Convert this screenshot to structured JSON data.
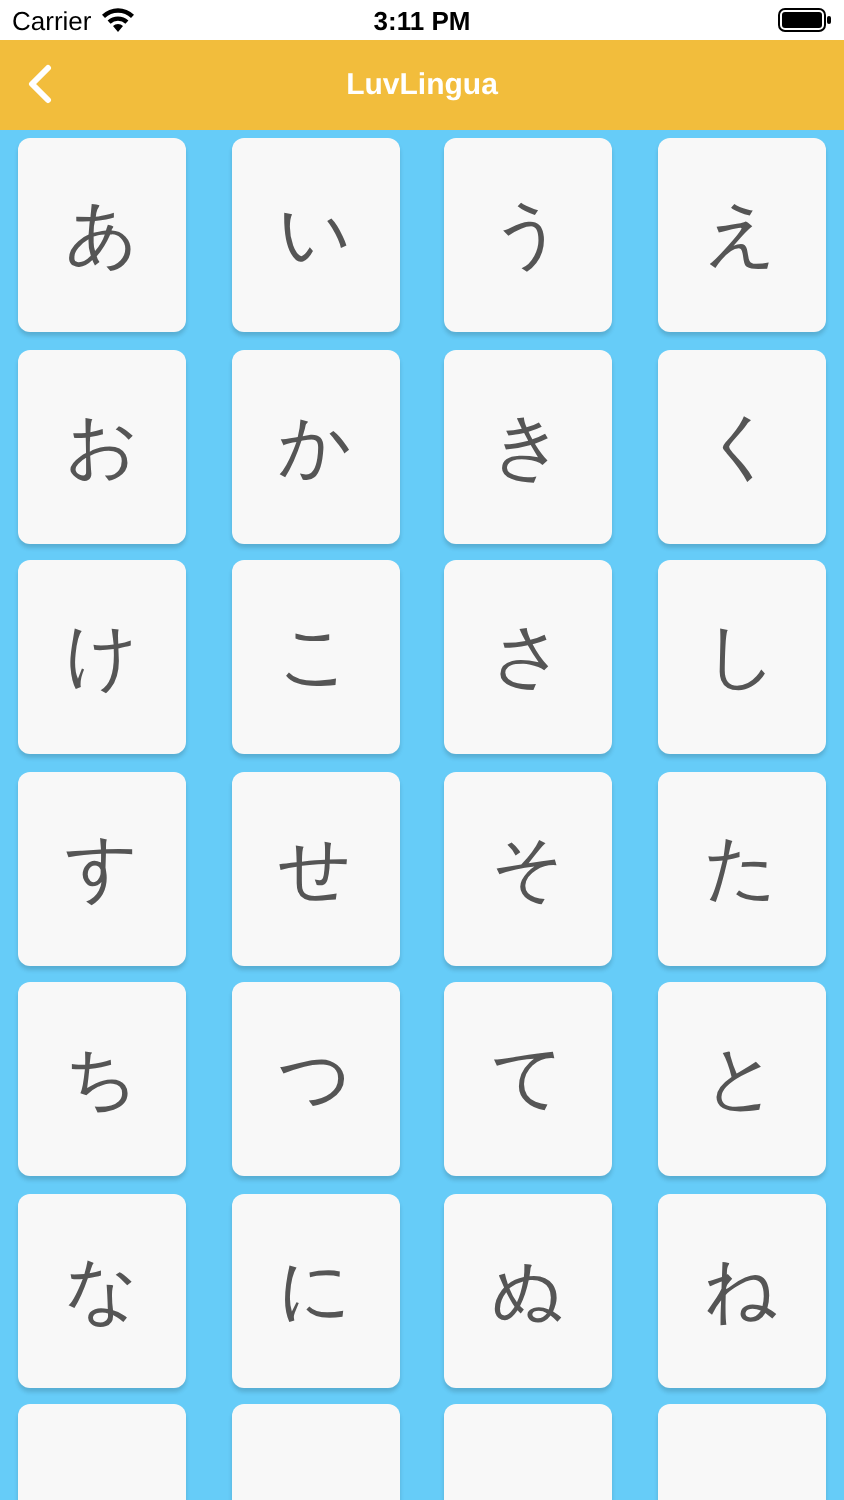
{
  "status_bar": {
    "carrier": "Carrier",
    "time": "3:11 PM"
  },
  "nav_bar": {
    "title": "LuvLingua"
  },
  "cards": [
    {
      "kind": "kana",
      "text": "あ"
    },
    {
      "kind": "kana",
      "text": "い"
    },
    {
      "kind": "kana",
      "text": "う"
    },
    {
      "kind": "kana",
      "text": "え"
    },
    {
      "kind": "kana",
      "text": "お"
    },
    {
      "kind": "kana",
      "text": "か"
    },
    {
      "kind": "kana",
      "text": "き"
    },
    {
      "kind": "kana",
      "text": "く"
    },
    {
      "kind": "kana",
      "text": "け"
    },
    {
      "kind": "kana",
      "text": "こ"
    },
    {
      "kind": "kana",
      "text": "さ"
    },
    {
      "kind": "kana",
      "text": "し"
    },
    {
      "kind": "kana",
      "text": "す"
    },
    {
      "kind": "kana",
      "text": "せ"
    },
    {
      "kind": "kana",
      "text": "そ"
    },
    {
      "kind": "kana",
      "text": "た"
    },
    {
      "kind": "kana",
      "text": "ち"
    },
    {
      "kind": "kana",
      "text": "つ"
    },
    {
      "kind": "kana",
      "text": "て"
    },
    {
      "kind": "kana",
      "text": "と"
    },
    {
      "kind": "kana",
      "text": "な"
    },
    {
      "kind": "kana",
      "text": "に"
    },
    {
      "kind": "kana",
      "text": "ぬ"
    },
    {
      "kind": "kana",
      "text": "ね"
    },
    {
      "kind": "cut"
    },
    {
      "kind": "cut"
    },
    {
      "kind": "cut"
    },
    {
      "kind": "cut"
    }
  ]
}
